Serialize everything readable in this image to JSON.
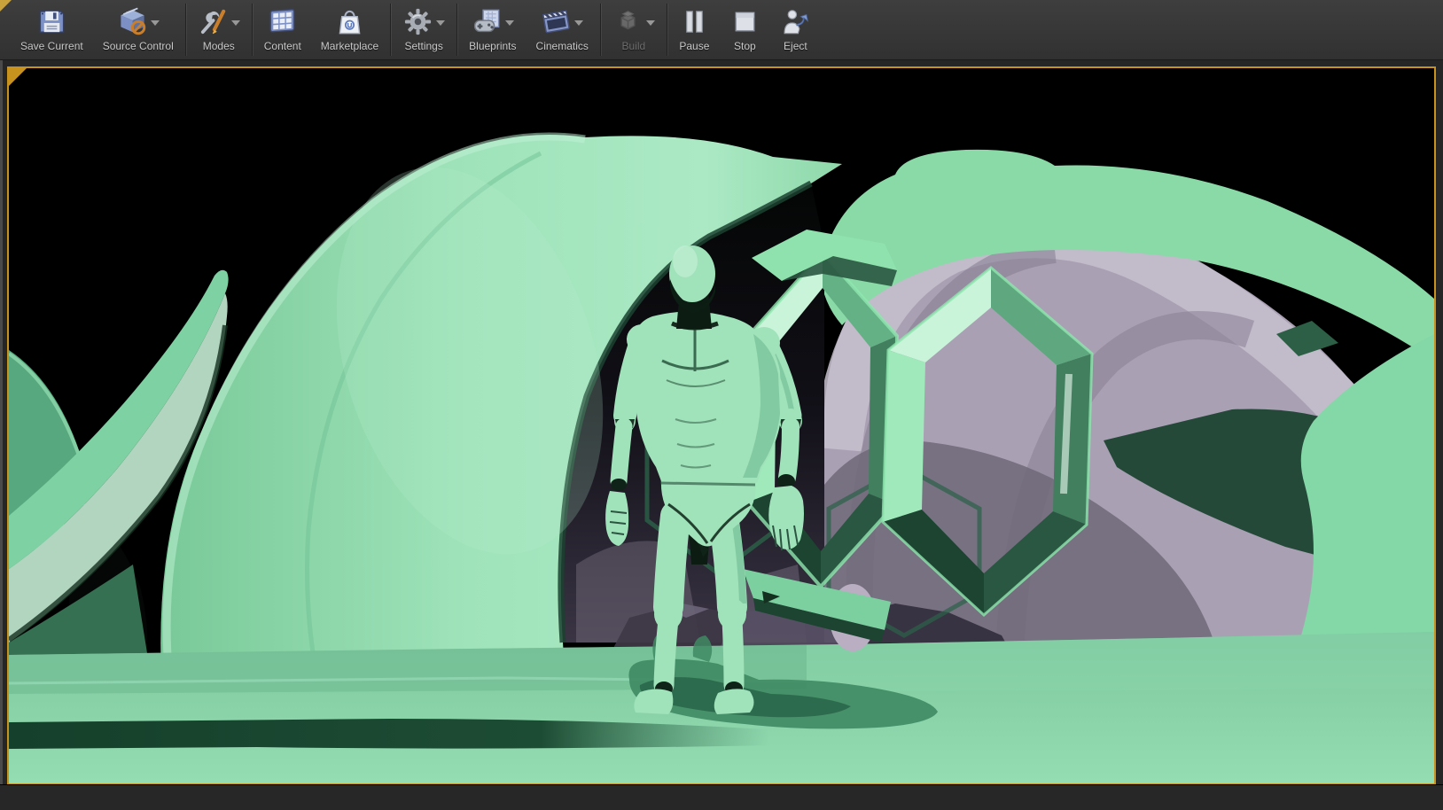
{
  "toolbar": {
    "groups": [
      {
        "buttons": [
          {
            "label": "Save Current",
            "icon": "save-icon",
            "enabled": true,
            "has_dropdown": false
          },
          {
            "label": "Source Control",
            "icon": "source-control-icon",
            "enabled": true,
            "has_dropdown": true
          }
        ]
      },
      {
        "buttons": [
          {
            "label": "Modes",
            "icon": "modes-icon",
            "enabled": true,
            "has_dropdown": true
          }
        ]
      },
      {
        "buttons": [
          {
            "label": "Content",
            "icon": "content-icon",
            "enabled": true,
            "has_dropdown": false
          },
          {
            "label": "Marketplace",
            "icon": "marketplace-icon",
            "enabled": true,
            "has_dropdown": false
          }
        ]
      },
      {
        "buttons": [
          {
            "label": "Settings",
            "icon": "settings-icon",
            "enabled": true,
            "has_dropdown": true
          }
        ]
      },
      {
        "buttons": [
          {
            "label": "Blueprints",
            "icon": "blueprints-icon",
            "enabled": true,
            "has_dropdown": true
          },
          {
            "label": "Cinematics",
            "icon": "cinematics-icon",
            "enabled": true,
            "has_dropdown": true
          }
        ]
      },
      {
        "buttons": [
          {
            "label": "Build",
            "icon": "build-icon",
            "enabled": false,
            "has_dropdown": true
          }
        ]
      },
      {
        "buttons": [
          {
            "label": "Pause",
            "icon": "pause-icon",
            "enabled": true,
            "has_dropdown": false
          },
          {
            "label": "Stop",
            "icon": "stop-icon",
            "enabled": true,
            "has_dropdown": false
          },
          {
            "label": "Eject",
            "icon": "eject-icon",
            "enabled": true,
            "has_dropdown": false
          }
        ]
      }
    ]
  },
  "viewport": {
    "scene_objects": [
      "mannequin-character",
      "hexagon-rings",
      "lavender-dome",
      "green-petal-arch",
      "left-horn-petals",
      "green-terrain",
      "character-shadow"
    ],
    "colors": {
      "pie_border": "#c8921e",
      "sky": "#000000",
      "arch_deep": "#79c998",
      "arch_light": "#a8e7c1",
      "arch_mid": "#8fd8ab",
      "arch_rim": "#c2f1d6",
      "green_dark": "#57a87e",
      "green_shadow": "#1d4531",
      "horn_outer": "#7ed1a2",
      "horn_inner": "#b2d5c0",
      "dome_light": "#c7bfce",
      "dome_mid": "#aaa0b4",
      "dome_dark": "#847b90",
      "dome_deep": "#6f6878",
      "rim_green": "#8adaa8",
      "petal_green": "#84d7a7",
      "hex_bright": "#8fe6ae",
      "hex_light": "#c9f4da",
      "hex_mid": "#9fe9bb",
      "hex_dark": "#1c4431",
      "hex_face": "#417f5e",
      "floor_band": "#74bd94",
      "shadow": "#3f8a63",
      "shadow_dark": "#276249",
      "body": "#a0e2ba",
      "body_light": "#cff2dd",
      "body_shade": "#6ab68e",
      "body_dark": "#0c1c13",
      "joint": "#102318",
      "muscle_line": "#3a6b50"
    }
  }
}
